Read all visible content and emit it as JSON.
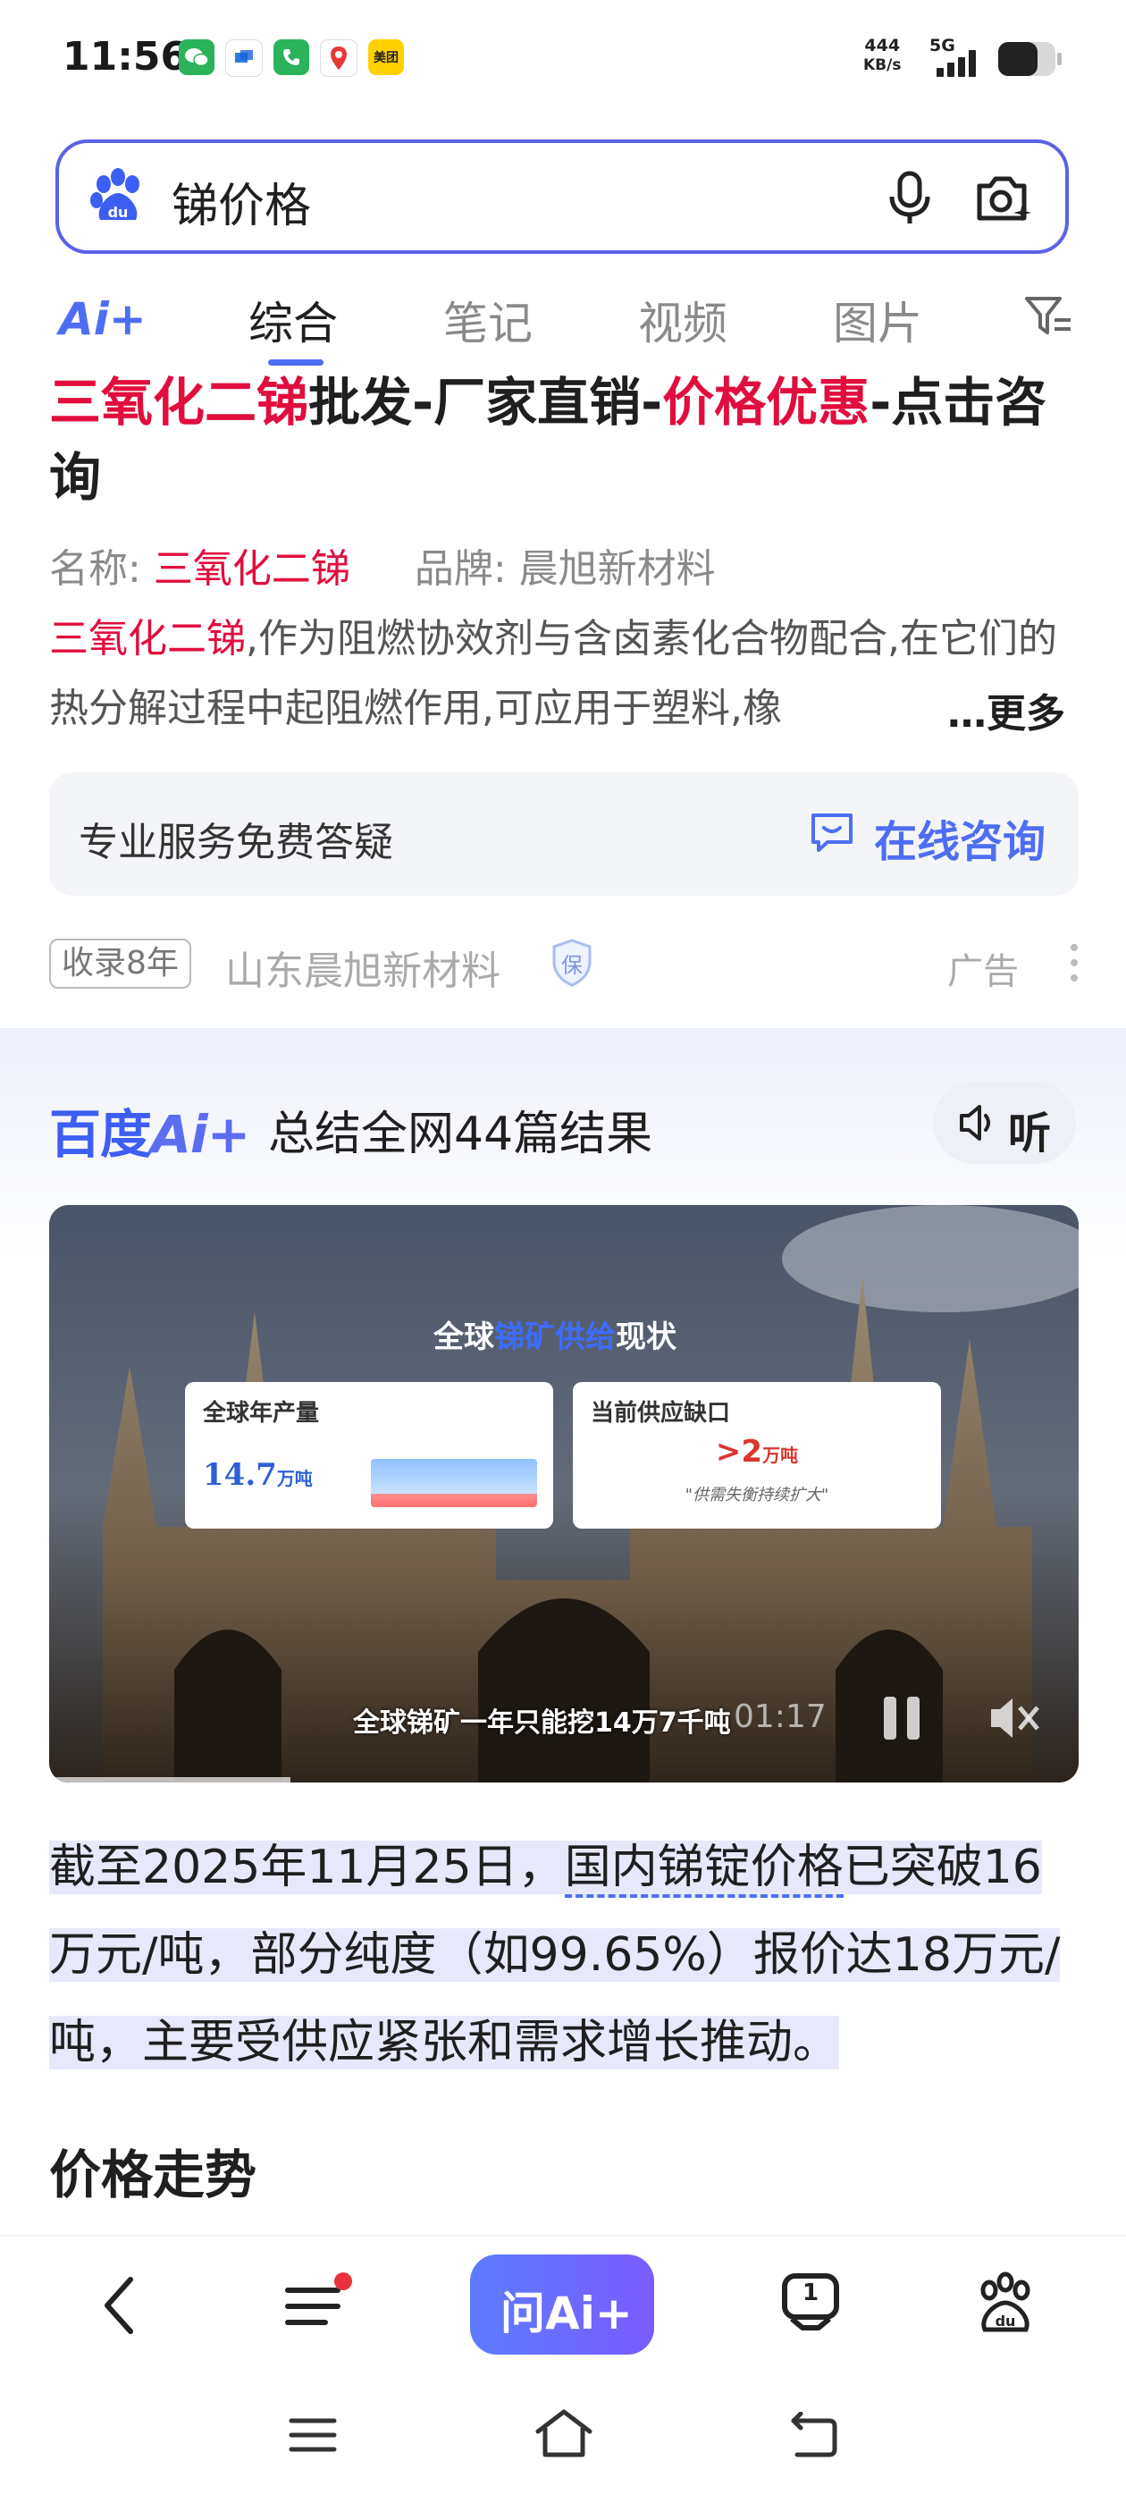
{
  "status_bar": {
    "time": "11:56",
    "net_speed": "444",
    "net_unit": "KB/s",
    "network": "5G",
    "app_icon_meituan": "美团"
  },
  "search": {
    "query": "锑价格"
  },
  "tabs": {
    "ai_logo": "Ai+",
    "items": [
      "综合",
      "笔记",
      "视频",
      "图片"
    ],
    "active": "综合"
  },
  "ad": {
    "title_parts": [
      "三氧化二锑",
      "批发-厂家直销-",
      "价格优惠",
      "-点击咨询"
    ],
    "name_label": "名称:",
    "name_value": "三氧化二锑",
    "brand_label": "品牌:",
    "brand_value": "晨旭新材料",
    "desc_lead": "三氧化二锑",
    "desc_rest": ",作为阻燃协效剂与含卤素化合物配合,在它们的热分解过程中起阻燃作用,可应用于塑料,橡",
    "more": "…更多",
    "consult_left": "专业服务免费答疑",
    "consult_right": "在线咨询",
    "years_badge": "收录8年",
    "source": "山东晨旭新材料",
    "shield": "保",
    "ad_label": "广告"
  },
  "ai_summary": {
    "brand_a": "百度",
    "brand_b": "Ai+",
    "header": "总结全网44篇结果",
    "listen": "听"
  },
  "video": {
    "title_a": "全球",
    "title_b": "锑矿供给",
    "title_c": "现状",
    "card1_title": "全球年产量",
    "card1_value": "14.7",
    "card1_unit": "万吨",
    "card2_title": "当前供应缺口",
    "card2_value": ">2",
    "card2_unit": "万吨",
    "card2_quote": "\"供需失衡持续扩大\"",
    "subtitle": "全球锑矿一年只能挖14万7千吨",
    "timestamp": "01:17",
    "progress": 0.13
  },
  "summary": {
    "part1": "截至2025年11月25日，",
    "part2": "国内锑锭价格",
    "part3": "已突破16万元/吨，部分纯度（如99.65%）报价达18万元/吨，主要受供应紧张和需求增长推动。"
  },
  "section_title": "价格走势",
  "bottom_nav": {
    "ask_ai": "问Ai+",
    "tab_count": "1"
  },
  "colors": {
    "accent": "#4e6ef2",
    "ad_red": "#e10e3d",
    "ai_gradient_start": "#5b7cff",
    "ai_gradient_end": "#7b5bff"
  }
}
